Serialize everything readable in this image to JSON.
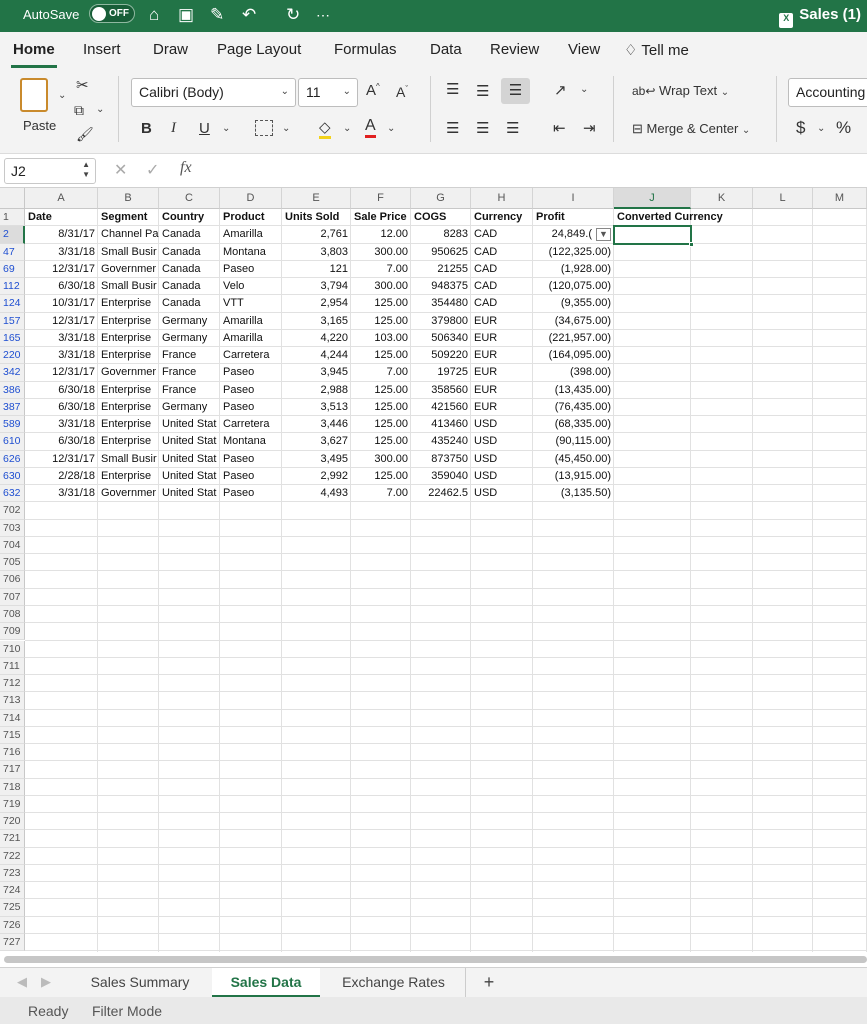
{
  "title_bar": {
    "autosave_label": "AutoSave",
    "autosave_state": "OFF",
    "doc_title": "Sales (1)",
    "icons": [
      "home-icon",
      "save-icon",
      "edit-icon",
      "undo-icon",
      "redo-icon",
      "more-icon"
    ]
  },
  "menu": {
    "tabs": [
      "Home",
      "Insert",
      "Draw",
      "Page Layout",
      "Formulas",
      "Data",
      "Review",
      "View"
    ],
    "tell_me": "Tell me",
    "active": "Home"
  },
  "ribbon": {
    "paste": "Paste",
    "font_name": "Calibri (Body)",
    "font_size": "11",
    "bold": "B",
    "italic": "I",
    "underline": "U",
    "wrap_text": "Wrap Text",
    "merge_center": "Merge & Center",
    "number_format": "Accounting",
    "currency": "$",
    "percent": "%"
  },
  "formula_bar": {
    "name_box": "J2",
    "fx": "fx",
    "formula": ""
  },
  "grid": {
    "columns": [
      "A",
      "B",
      "C",
      "D",
      "E",
      "F",
      "G",
      "H",
      "I",
      "J",
      "K",
      "L",
      "M"
    ],
    "selected_column": "J",
    "headers": [
      "Date",
      "Segment",
      "Country",
      "Product",
      "Units Sold",
      "Sale Price",
      "COGS",
      "Currency",
      "Profit",
      "Converted Currency"
    ],
    "rows": [
      {
        "row": "2",
        "date": "8/31/17",
        "segment": "Channel Pa",
        "country": "Canada",
        "product": "Amarilla",
        "units": "2,761",
        "price": "12.00",
        "cogs": "8283",
        "currency": "CAD",
        "profit": "24,849.("
      },
      {
        "row": "47",
        "date": "3/31/18",
        "segment": "Small Busir",
        "country": "Canada",
        "product": "Montana",
        "units": "3,803",
        "price": "300.00",
        "cogs": "950625",
        "currency": "CAD",
        "profit": "(122,325.00)"
      },
      {
        "row": "69",
        "date": "12/31/17",
        "segment": "Governmer",
        "country": "Canada",
        "product": "Paseo",
        "units": "121",
        "price": "7.00",
        "cogs": "21255",
        "currency": "CAD",
        "profit": "(1,928.00)"
      },
      {
        "row": "112",
        "date": "6/30/18",
        "segment": "Small Busir",
        "country": "Canada",
        "product": "Velo",
        "units": "3,794",
        "price": "300.00",
        "cogs": "948375",
        "currency": "CAD",
        "profit": "(120,075.00)"
      },
      {
        "row": "124",
        "date": "10/31/17",
        "segment": "Enterprise",
        "country": "Canada",
        "product": "VTT",
        "units": "2,954",
        "price": "125.00",
        "cogs": "354480",
        "currency": "CAD",
        "profit": "(9,355.00)"
      },
      {
        "row": "157",
        "date": "12/31/17",
        "segment": "Enterprise",
        "country": "Germany",
        "product": "Amarilla",
        "units": "3,165",
        "price": "125.00",
        "cogs": "379800",
        "currency": "EUR",
        "profit": "(34,675.00)"
      },
      {
        "row": "165",
        "date": "3/31/18",
        "segment": "Enterprise",
        "country": "Germany",
        "product": "Amarilla",
        "units": "4,220",
        "price": "103.00",
        "cogs": "506340",
        "currency": "EUR",
        "profit": "(221,957.00)"
      },
      {
        "row": "220",
        "date": "3/31/18",
        "segment": "Enterprise",
        "country": "France",
        "product": "Carretera",
        "units": "4,244",
        "price": "125.00",
        "cogs": "509220",
        "currency": "EUR",
        "profit": "(164,095.00)"
      },
      {
        "row": "342",
        "date": "12/31/17",
        "segment": "Governmer",
        "country": "France",
        "product": "Paseo",
        "units": "3,945",
        "price": "7.00",
        "cogs": "19725",
        "currency": "EUR",
        "profit": "(398.00)"
      },
      {
        "row": "386",
        "date": "6/30/18",
        "segment": "Enterprise",
        "country": "France",
        "product": "Paseo",
        "units": "2,988",
        "price": "125.00",
        "cogs": "358560",
        "currency": "EUR",
        "profit": "(13,435.00)"
      },
      {
        "row": "387",
        "date": "6/30/18",
        "segment": "Enterprise",
        "country": "Germany",
        "product": "Paseo",
        "units": "3,513",
        "price": "125.00",
        "cogs": "421560",
        "currency": "EUR",
        "profit": "(76,435.00)"
      },
      {
        "row": "589",
        "date": "3/31/18",
        "segment": "Enterprise",
        "country": "United Stat",
        "product": "Carretera",
        "units": "3,446",
        "price": "125.00",
        "cogs": "413460",
        "currency": "USD",
        "profit": "(68,335.00)"
      },
      {
        "row": "610",
        "date": "6/30/18",
        "segment": "Enterprise",
        "country": "United Stat",
        "product": "Montana",
        "units": "3,627",
        "price": "125.00",
        "cogs": "435240",
        "currency": "USD",
        "profit": "(90,115.00)"
      },
      {
        "row": "626",
        "date": "12/31/17",
        "segment": "Small Busir",
        "country": "United Stat",
        "product": "Paseo",
        "units": "3,495",
        "price": "300.00",
        "cogs": "873750",
        "currency": "USD",
        "profit": "(45,450.00)"
      },
      {
        "row": "630",
        "date": "2/28/18",
        "segment": "Enterprise",
        "country": "United Stat",
        "product": "Paseo",
        "units": "2,992",
        "price": "125.00",
        "cogs": "359040",
        "currency": "USD",
        "profit": "(13,915.00)"
      },
      {
        "row": "632",
        "date": "3/31/18",
        "segment": "Governmer",
        "country": "United Stat",
        "product": "Paseo",
        "units": "4,493",
        "price": "7.00",
        "cogs": "22462.5",
        "currency": "USD",
        "profit": "(3,135.50)"
      }
    ],
    "empty_rows": [
      "702",
      "703",
      "704",
      "705",
      "706",
      "707",
      "708",
      "709",
      "710",
      "711",
      "712",
      "713",
      "714",
      "715",
      "716",
      "717",
      "718",
      "719",
      "720",
      "721",
      "722",
      "723",
      "724",
      "725",
      "726",
      "727"
    ]
  },
  "sheet_tabs": [
    "Sales Summary",
    "Sales Data",
    "Exchange Rates"
  ],
  "active_sheet": "Sales Data",
  "add_sheet": "+",
  "status": {
    "ready": "Ready",
    "mode": "Filter Mode"
  },
  "colors": {
    "excel_green": "#227447",
    "filtered_row_number": "#1f4fd1"
  }
}
